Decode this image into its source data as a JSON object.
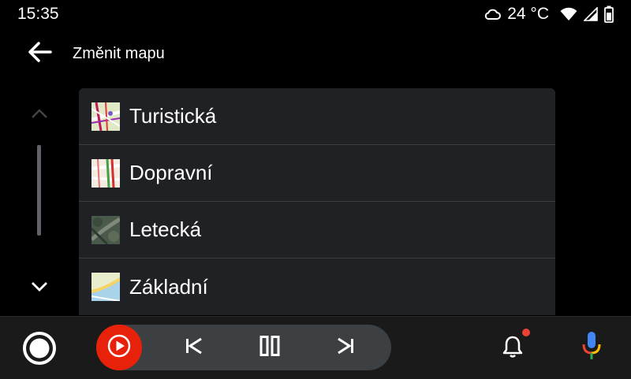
{
  "status": {
    "time": "15:35",
    "temperature": "24 °C",
    "icons": [
      "cloud-icon",
      "wifi-icon",
      "signal-icon",
      "battery-icon"
    ]
  },
  "header": {
    "title": "Změnit mapu",
    "back_icon": "arrow-back-icon"
  },
  "scroll": {
    "up_icon": "chevron-up-icon",
    "down_icon": "chevron-down-icon"
  },
  "maps": {
    "items": [
      {
        "label": "Turistická",
        "icon": "map-tourist-thumbnail"
      },
      {
        "label": "Dopravní",
        "icon": "map-traffic-thumbnail"
      },
      {
        "label": "Letecká",
        "icon": "map-aerial-thumbnail"
      },
      {
        "label": "Základní",
        "icon": "map-basic-thumbnail"
      }
    ]
  },
  "bottom_bar": {
    "home_icon": "home-circle-icon",
    "media_app_icon": "youtube-music-icon",
    "controls": [
      "skip-previous-icon",
      "pause-icon",
      "skip-next-icon"
    ],
    "notification_icon": "bell-icon",
    "assistant_icon": "microphone-icon"
  },
  "colors": {
    "background": "#000000",
    "list_background": "#202124",
    "divider": "#3c4043",
    "media_app": "#e8210b",
    "notification_dot": "#ea4335",
    "mic_blue": "#4285f4",
    "mic_red": "#ea4335",
    "mic_yellow": "#fbbc05",
    "mic_green": "#34a853"
  }
}
